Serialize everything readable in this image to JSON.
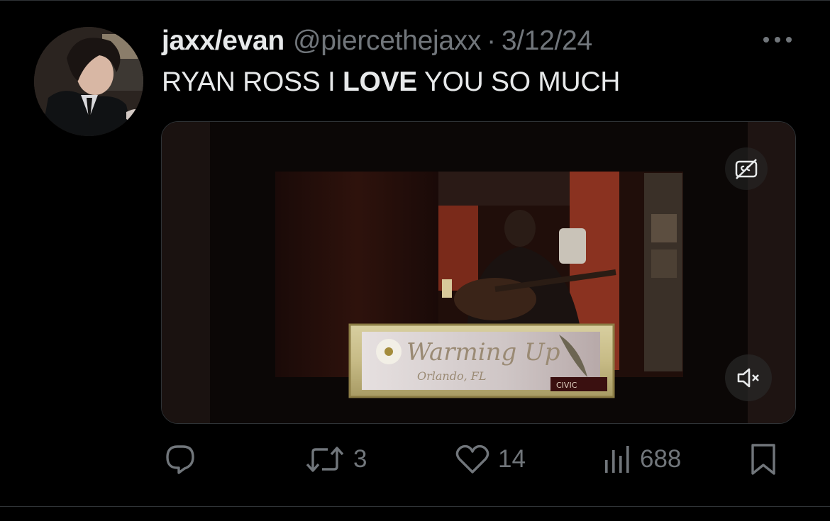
{
  "tweet": {
    "display_name": "jaxx/evan",
    "handle": "@piercethejaxx",
    "separator": "·",
    "date": "3/12/24",
    "text_before": "RYAN ROSS I ",
    "text_bold": "LOVE",
    "text_after": " YOU SO MUCH"
  },
  "media": {
    "overlay_title": "Warming Up",
    "overlay_subtitle": "Orlando, FL",
    "overlay_logo": "CIVIC",
    "captions_icon": "closed-captions-off-icon",
    "mute_icon": "volume-muted-icon"
  },
  "actions": {
    "reply": {
      "icon": "reply-icon",
      "count": ""
    },
    "retweet": {
      "icon": "retweet-icon",
      "count": "3"
    },
    "like": {
      "icon": "heart-icon",
      "count": "14"
    },
    "views": {
      "icon": "views-icon",
      "count": "688"
    },
    "bookmark": {
      "icon": "bookmark-icon"
    }
  },
  "colors": {
    "background": "#000000",
    "text": "#e7e9ea",
    "muted": "#71767b",
    "border": "#2f3336"
  }
}
